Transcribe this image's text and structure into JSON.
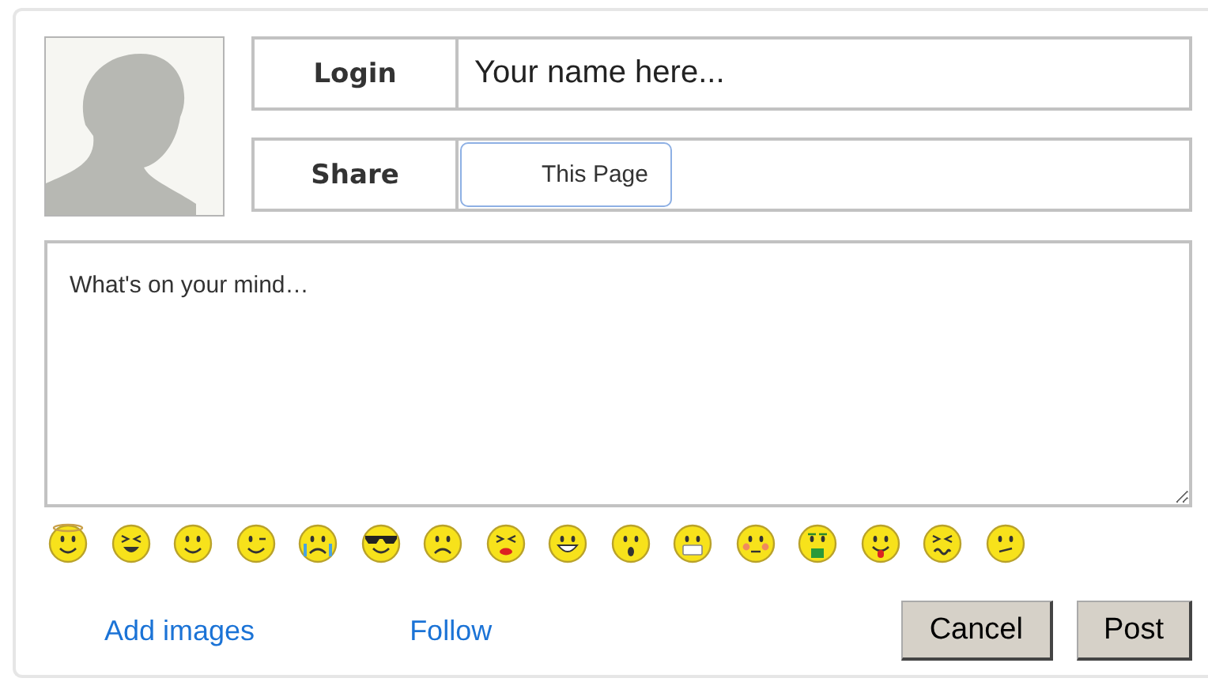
{
  "login": {
    "label": "Login",
    "placeholder": "Your name here..."
  },
  "share": {
    "label": "Share",
    "button": "This Page"
  },
  "message": {
    "placeholder": "What's on your mind…"
  },
  "links": [
    "Add images",
    "Follow"
  ],
  "buttons": [
    "Cancel",
    "Post"
  ]
}
